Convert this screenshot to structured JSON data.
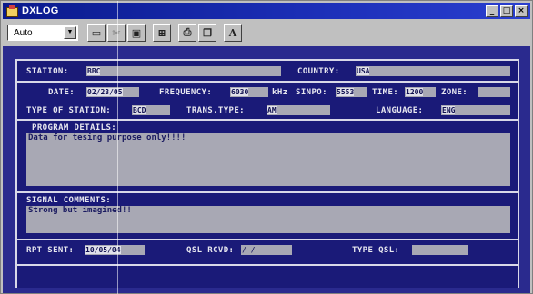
{
  "window": {
    "title": "DXLOG"
  },
  "title_buttons": {
    "minimize": "_",
    "maximize": "□",
    "close": "×"
  },
  "toolbar": {
    "font_select": "Auto",
    "tool_icons": [
      "blank-page-icon",
      "cut-icon",
      "save-icon",
      "grid-icon",
      "print-icon",
      "window-icon",
      "font-icon"
    ],
    "font_button_label": "A"
  },
  "form": {
    "station": {
      "label": "STATION:",
      "value": "BBC"
    },
    "country": {
      "label": "COUNTRY:",
      "value": "USA"
    },
    "date": {
      "label": "DATE:",
      "value": "02/23/05"
    },
    "frequency": {
      "label": "FREQUENCY:",
      "value": "6030",
      "unit": "kHz"
    },
    "sinpo": {
      "label": "SINPO:",
      "value": "5553"
    },
    "time": {
      "label": "TIME:",
      "value": "1200"
    },
    "zone": {
      "label": "ZONE:",
      "value": ""
    },
    "station_type": {
      "label": "TYPE OF STATION:",
      "value": "BCD"
    },
    "trans_type": {
      "label": "TRANS.TYPE:",
      "value": "AM"
    },
    "language": {
      "label": "LANGUAGE:",
      "value": "ENG"
    },
    "program_details": {
      "label": "PROGRAM DETAILS:",
      "value": "Data for tesing purpose only!!!!"
    },
    "signal_comments": {
      "label": "SIGNAL COMMENTS:",
      "value": "Strong but imagined!!"
    },
    "rpt_sent": {
      "label": "RPT SENT:",
      "value": "10/05/04"
    },
    "qsl_rcvd": {
      "label": "QSL RCVD:",
      "value": " / /"
    },
    "type_qsl": {
      "label": "TYPE QSL:",
      "value": ""
    }
  },
  "colors": {
    "background": "#1a1a78",
    "field": "#a8a8b4",
    "label": "#e8e8f0",
    "titlebar": "#0a1a8c"
  }
}
